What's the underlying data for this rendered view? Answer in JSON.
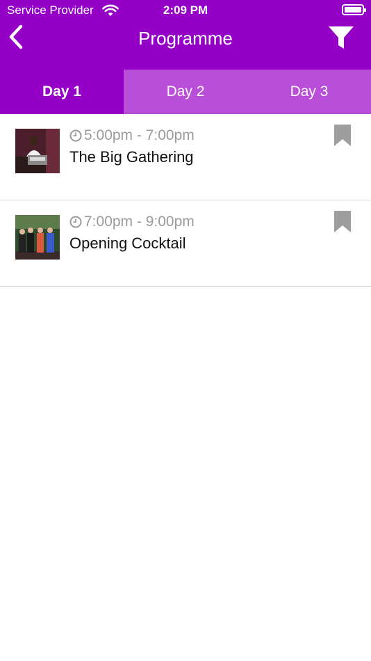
{
  "status_bar": {
    "carrier": "Service Provider",
    "time": "2:09 PM"
  },
  "header": {
    "title": "Programme",
    "back_icon": "chevron-left-icon",
    "filter_icon": "filter-icon"
  },
  "tabs": [
    {
      "label": "Day 1",
      "active": true
    },
    {
      "label": "Day 2",
      "active": false
    },
    {
      "label": "Day 3",
      "active": false
    }
  ],
  "events": [
    {
      "time": "5:00pm - 7:00pm",
      "title": "The Big Gathering",
      "bookmarked": false
    },
    {
      "time": "7:00pm - 9:00pm",
      "title": "Opening Cocktail",
      "bookmarked": false
    }
  ],
  "colors": {
    "brand": "#9400c6",
    "tab_inactive": "#b94ed9",
    "muted_text": "#9a9a9a",
    "bookmark": "#9e9e9e"
  }
}
